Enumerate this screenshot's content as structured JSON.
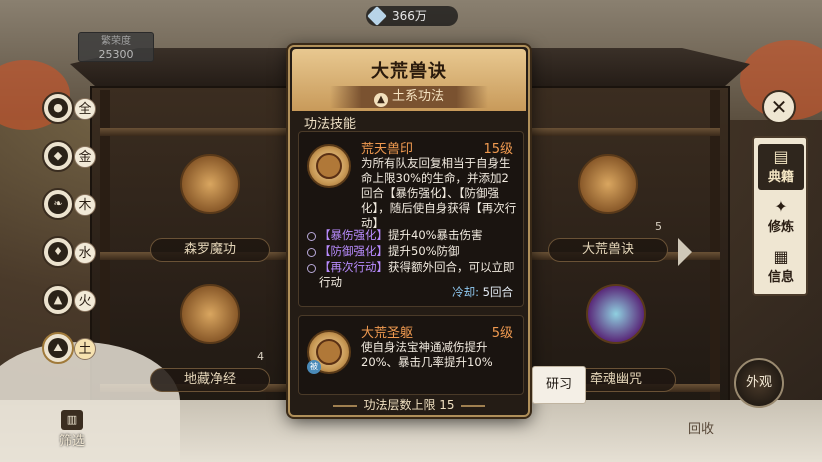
{
  "top_bar": {
    "currency_value": "366万",
    "currency_icon": "gem-icon"
  },
  "prosperity": {
    "label": "繁荣度",
    "value": "25300"
  },
  "elements": [
    {
      "label": "全",
      "icon": "all-icon"
    },
    {
      "label": "金",
      "icon": "metal-icon"
    },
    {
      "label": "木",
      "icon": "wood-icon"
    },
    {
      "label": "水",
      "icon": "water-icon"
    },
    {
      "label": "火",
      "icon": "fire-icon"
    },
    {
      "label": "土",
      "icon": "earth-icon",
      "active": true
    }
  ],
  "background_cards": [
    {
      "name": "森罗魔功",
      "level": ""
    },
    {
      "name": "大荒兽诀",
      "level": "5"
    },
    {
      "name": "地藏净经",
      "level": "4"
    },
    {
      "name": "牵魂幽咒",
      "level": ""
    }
  ],
  "right_nav": {
    "close": "✕",
    "tabs": [
      {
        "label": "典籍",
        "icon": "book-icon",
        "selected": true
      },
      {
        "label": "修炼",
        "icon": "cultivate-icon"
      },
      {
        "label": "信息",
        "icon": "info-icon"
      }
    ],
    "appearance": "外观",
    "collect": "回收"
  },
  "filter": {
    "label": "筛选"
  },
  "modal": {
    "title": "大荒兽诀",
    "school": "土系功法",
    "section_label": "功法技能",
    "skills": [
      {
        "name": "荒天兽印",
        "level": "15级",
        "description": "为所有队友回复相当于自身生命上限30%的生命，并添加2回合【暴伤强化】、【防御强化】，随后使自身获得【再次行动】",
        "buffs": [
          {
            "name": "【暴伤强化】",
            "text": "提升40%暴击伤害"
          },
          {
            "name": "【防御强化】",
            "text": "提升50%防御"
          },
          {
            "name": "【再次行动】",
            "text": "获得额外回合，可以立即行动"
          }
        ],
        "cooldown_label": "冷却:",
        "cooldown_value": "5回合"
      },
      {
        "name": "大荒圣躯",
        "level": "5级",
        "tag": "被",
        "description": "使自身法宝神通减伤提升20%、暴击几率提升10%"
      }
    ],
    "footer": "功法层数上限 15"
  },
  "research_button": "研习",
  "colors": {
    "accent": "#f09a50",
    "buff": "#b98cff",
    "cooldown": "#8fc8f0",
    "frame": "#b0905a"
  }
}
